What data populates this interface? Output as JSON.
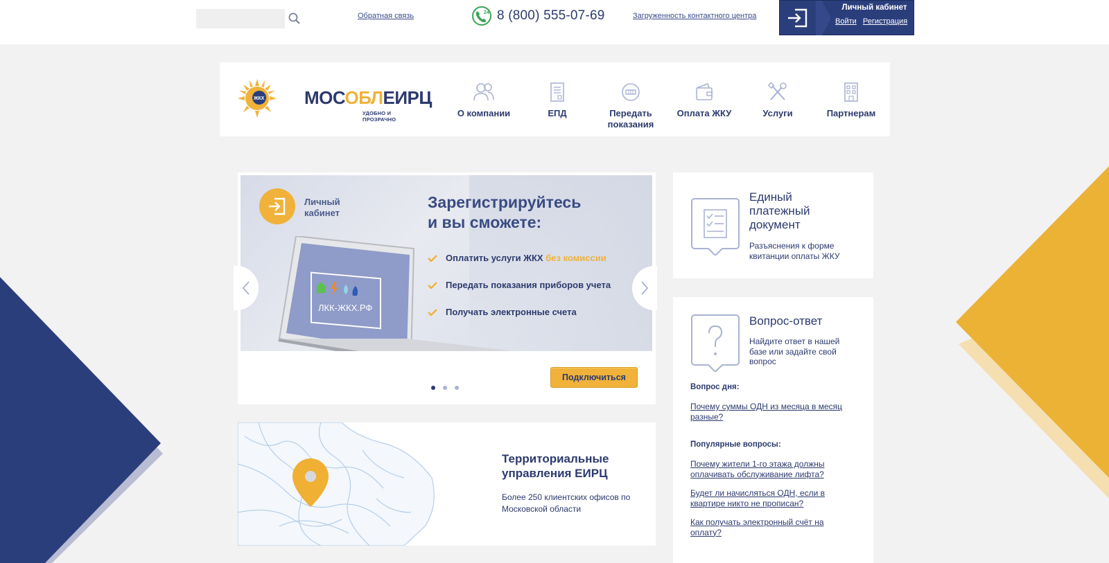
{
  "topbar": {
    "search_placeholder": "",
    "feedback_link": "Обратная связь",
    "phone_badge": "24",
    "phone": "8 (800) 555-07-69",
    "load_link": "Загруженность контактного центра",
    "account": {
      "title": "Личный кабинет",
      "login": "Войти",
      "register": "Регистрация"
    }
  },
  "logo": {
    "part1": "МОС",
    "part2": "ОБЛ",
    "part3": "ЕИРЦ",
    "tagline": "УДОБНО И ПРОЗРАЧНО",
    "sun_text": "ЖКХ"
  },
  "nav": [
    {
      "label": "О компании",
      "icon": "users-icon"
    },
    {
      "label": "ЕПД",
      "icon": "document-icon"
    },
    {
      "label": "Передать показания",
      "icon": "meter-icon"
    },
    {
      "label": "Оплата ЖКУ",
      "icon": "wallet-icon"
    },
    {
      "label": "Услуги",
      "icon": "tools-icon"
    },
    {
      "label": "Партнерам",
      "icon": "building-icon"
    }
  ],
  "slider": {
    "badge_text": "Личный кабинет",
    "title_line1": "Зарегистрируйтесь",
    "title_line2": "и вы сможете:",
    "items": [
      {
        "text": "Оплатить услуги ЖКХ",
        "accent": "без комиссии"
      },
      {
        "text": "Передать показания приборов учета",
        "accent": ""
      },
      {
        "text": "Получать электронные счета",
        "accent": ""
      }
    ],
    "screen_text": "ЛКК-ЖКХ.РФ",
    "connect_button": "Подключиться",
    "active_slide": 1,
    "slide_count": 3
  },
  "map_card": {
    "title": "Территориальные управления ЕИРЦ",
    "desc": "Более 250 клиентских офисов по Московской области"
  },
  "epd_card": {
    "title": "Единый платежный документ",
    "desc": "Разъяснения к форме квитанции оплаты ЖКУ"
  },
  "faq_card": {
    "title": "Вопрос-ответ",
    "desc": "Найдите ответ в нашей базе или задайте свой вопрос",
    "day_label": "Вопрос дня:",
    "day_question": "Почему суммы ОДН из месяца в месяц разные?",
    "popular_label": "Популярные вопросы:",
    "popular": [
      "Почему жители 1-го этажа должны оплачивать обслуживание лифта?",
      "Будет ли начисляться ОДН, если в квартире никто не прописан?",
      "Как получать электронный счёт на оплату?"
    ]
  },
  "colors": {
    "navy": "#2b3e7c",
    "gold": "#f0b23a",
    "text": "#2d3a6e",
    "background": "#f2f2f2"
  }
}
